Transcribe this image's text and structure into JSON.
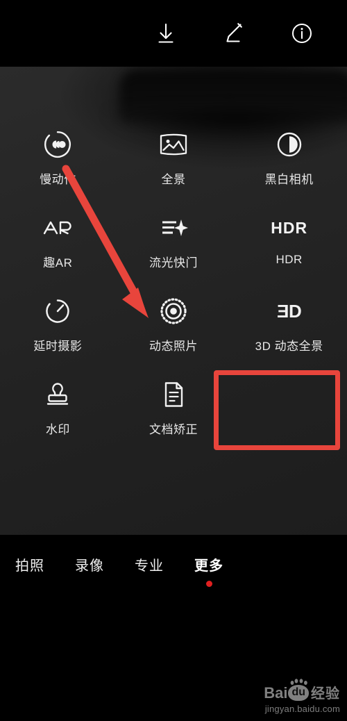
{
  "topbar": {
    "actions": [
      {
        "name": "download-icon",
        "label": "Download"
      },
      {
        "name": "edit-icon",
        "label": "Edit"
      },
      {
        "name": "info-icon",
        "label": "Info"
      }
    ]
  },
  "modes": [
    {
      "label": "慢动作",
      "icon": "slow-motion-icon",
      "highlighted": false
    },
    {
      "label": "全景",
      "icon": "panorama-icon",
      "highlighted": false
    },
    {
      "label": "黑白相机",
      "icon": "monochrome-camera-icon",
      "highlighted": false
    },
    {
      "label": "趣AR",
      "icon": "ar-icon",
      "glyph": "AR",
      "highlighted": false
    },
    {
      "label": "流光快门",
      "icon": "light-painting-icon",
      "highlighted": false
    },
    {
      "label": "HDR",
      "icon": "hdr-icon",
      "glyph": "HDR",
      "highlighted": false
    },
    {
      "label": "延时摄影",
      "icon": "time-lapse-icon",
      "highlighted": false
    },
    {
      "label": "动态照片",
      "icon": "motion-photo-icon",
      "highlighted": false
    },
    {
      "label": "3D 动态全景",
      "icon": "3d-panorama-icon",
      "glyph": "3D",
      "highlighted": true
    }
  ],
  "modes_row4": [
    {
      "label": "水印",
      "icon": "watermark-stamp-icon",
      "highlighted": false
    },
    {
      "label": "文档矫正",
      "icon": "document-correction-icon",
      "highlighted": false
    }
  ],
  "tabs": [
    {
      "label": "拍照",
      "active": false
    },
    {
      "label": "录像",
      "active": false
    },
    {
      "label": "专业",
      "active": false
    },
    {
      "label": "更多",
      "active": true
    }
  ],
  "annotation": {
    "arrow_color": "#e8453c",
    "highlight_color": "#e8453c",
    "arrow_from": "190,243",
    "arrow_to": "305,455"
  },
  "watermark": {
    "bai": "Bai",
    "du": "du",
    "jingyan": "经验",
    "url": "jingyan.baidu.com"
  }
}
